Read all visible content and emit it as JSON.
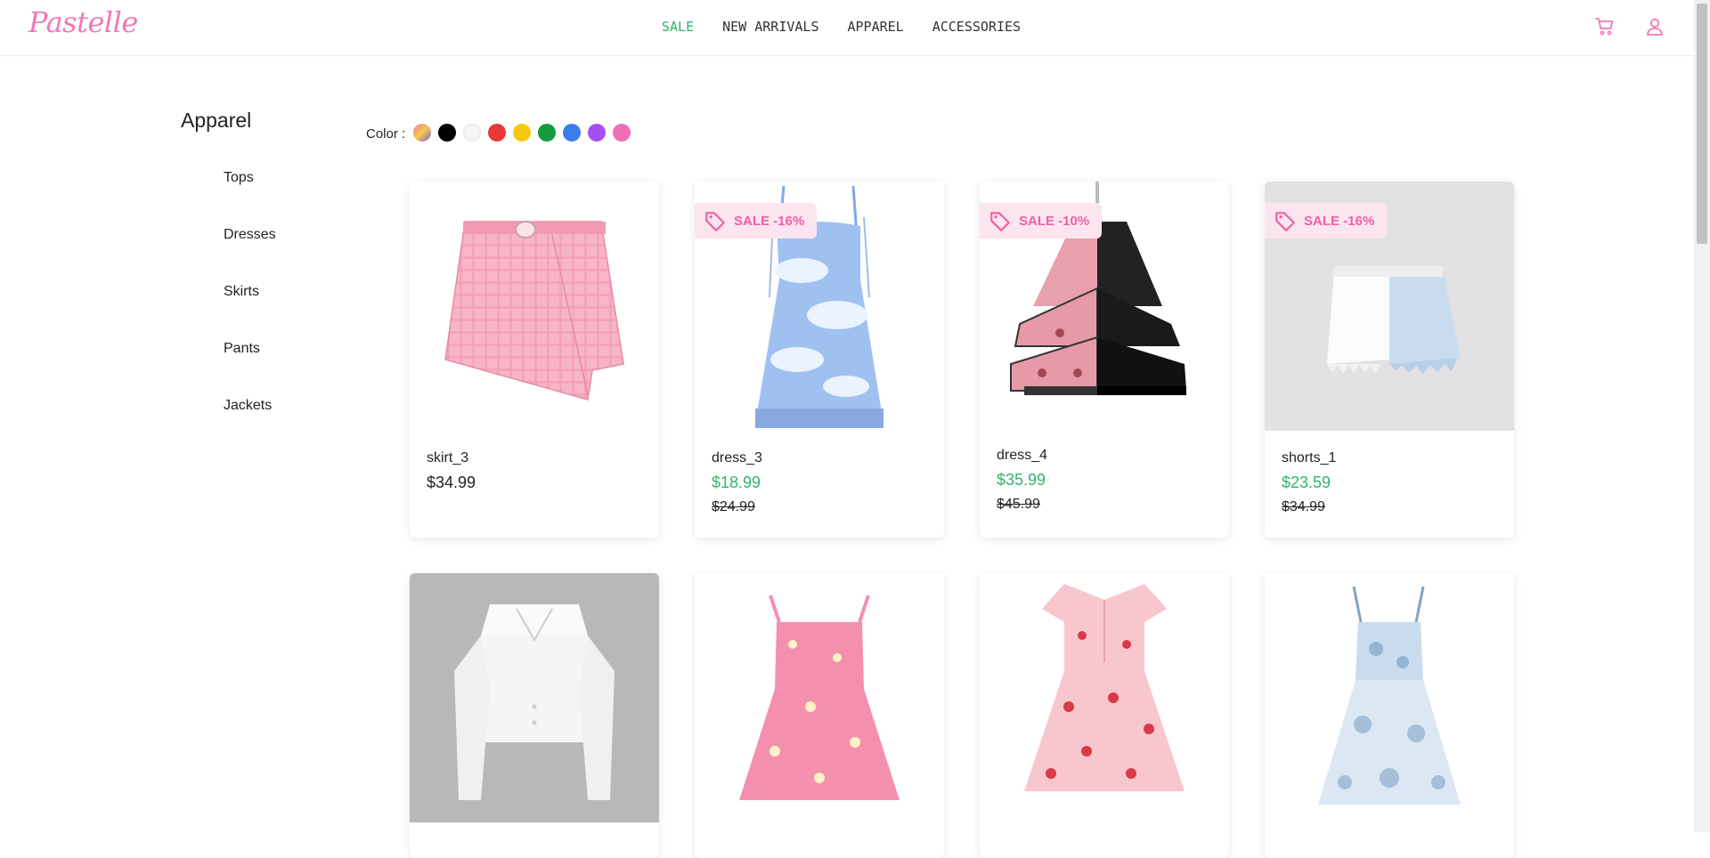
{
  "brand": "Pastelle",
  "nav": [
    {
      "label": "SALE",
      "accent": "#2fb56b"
    },
    {
      "label": "NEW ARRIVALS"
    },
    {
      "label": "APPAREL"
    },
    {
      "label": "ACCESSORIES"
    }
  ],
  "header_icons": [
    "cart-icon",
    "user-icon"
  ],
  "sidebar": {
    "title": "Apparel",
    "items": [
      "Tops",
      "Dresses",
      "Skirts",
      "Pants",
      "Jackets"
    ]
  },
  "filter": {
    "label": "Color :",
    "colors": [
      {
        "name": "multicolor",
        "value": "linear-gradient(135deg,#f07ab3,#f6c945,#7c5cf0)"
      },
      {
        "name": "black",
        "value": "#000000"
      },
      {
        "name": "white",
        "value": "#f4f4f4"
      },
      {
        "name": "red",
        "value": "#e63838"
      },
      {
        "name": "yellow",
        "value": "#f6c90e"
      },
      {
        "name": "green",
        "value": "#169c40"
      },
      {
        "name": "blue",
        "value": "#3b7ded"
      },
      {
        "name": "purple",
        "value": "#a64ff0"
      },
      {
        "name": "pink",
        "value": "#ef6fb0"
      }
    ]
  },
  "products": [
    {
      "name": "skirt_3",
      "price": "$34.99",
      "sale": null,
      "old_price": null,
      "image": "pink-plaid-skirt"
    },
    {
      "name": "dress_3",
      "price": "$18.99",
      "sale": "SALE -16%",
      "old_price": "$24.99",
      "image": "blue-cloud-dress"
    },
    {
      "name": "dress_4",
      "price": "$35.99",
      "sale": "SALE -10%",
      "old_price": "$45.99",
      "image": "pink-black-lolita-dress"
    },
    {
      "name": "shorts_1",
      "price": "$23.59",
      "sale": "SALE -16%",
      "old_price": "$34.99",
      "image": "two-tone-denim-shorts"
    },
    {
      "name": "",
      "price": "",
      "sale": null,
      "old_price": null,
      "image": "white-cropped-blouse"
    },
    {
      "name": "",
      "price": "",
      "sale": null,
      "old_price": null,
      "image": "pink-daisy-dress"
    },
    {
      "name": "",
      "price": "",
      "sale": null,
      "old_price": null,
      "image": "strawberry-print-dress"
    },
    {
      "name": "",
      "price": "",
      "sale": null,
      "old_price": null,
      "image": "blue-toile-dress"
    }
  ]
}
